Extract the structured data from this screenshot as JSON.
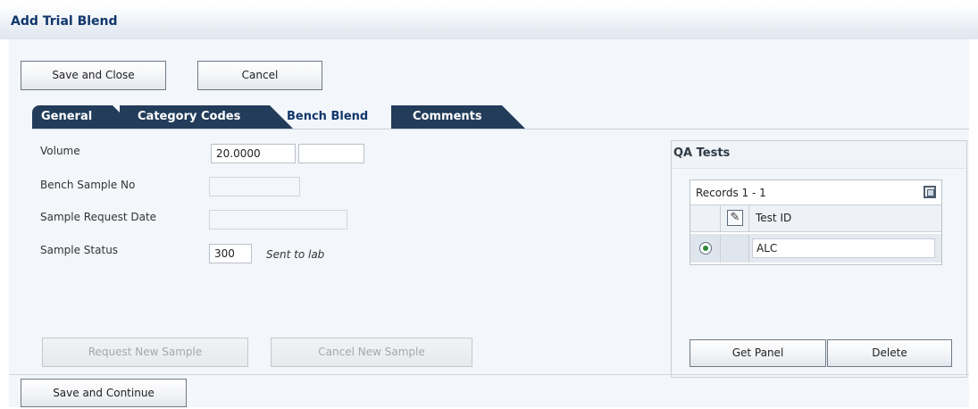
{
  "page": {
    "title": "Add Trial Blend"
  },
  "toolbar": {
    "save_close_label": "Save and Close",
    "cancel_label": "Cancel"
  },
  "tabs": [
    {
      "label": "General",
      "active": false
    },
    {
      "label": "Category Codes",
      "active": false
    },
    {
      "label": "Bench Blend",
      "active": true
    },
    {
      "label": "Comments",
      "active": false
    }
  ],
  "form": {
    "volume": {
      "label": "Volume",
      "value": "20.0000",
      "uom": ""
    },
    "bench_sample_no": {
      "label": "Bench Sample No",
      "value": ""
    },
    "sample_request_date": {
      "label": "Sample Request Date",
      "value": ""
    },
    "sample_status": {
      "label": "Sample Status",
      "value": "300",
      "description": "Sent to lab"
    }
  },
  "sample_buttons": {
    "request_new_sample": "Request New Sample",
    "cancel_new_sample": "Cancel New Sample"
  },
  "qa_tests": {
    "title": "QA Tests",
    "records_label": "Records 1 - 1",
    "columns": {
      "test_id": "Test ID"
    },
    "rows": [
      {
        "test_id": "ALC",
        "selected": true
      }
    ],
    "get_panel_label": "Get Panel",
    "delete_label": "Delete"
  },
  "footer": {
    "save_continue_label": "Save and Continue"
  }
}
